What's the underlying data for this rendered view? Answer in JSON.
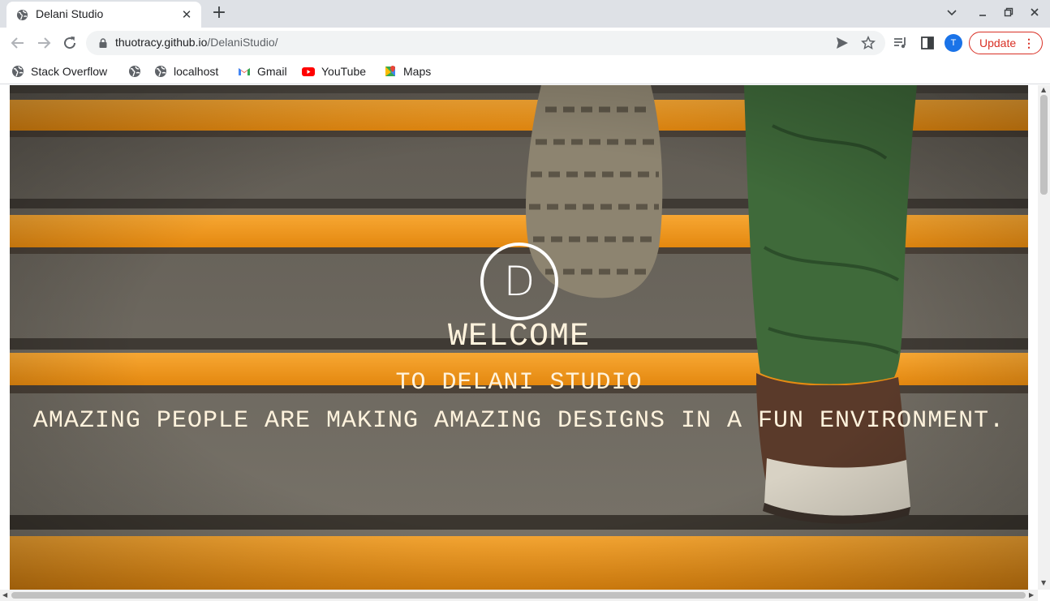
{
  "browser": {
    "tab_title": "Delani Studio",
    "tab_close": "✕",
    "new_tab": "+",
    "url_host": "thuotracy.github.io",
    "url_path": "/DelaniStudio/",
    "avatar_letter": "T",
    "update_label": "Update",
    "update_menu": "⋮"
  },
  "bookmarks": [
    {
      "label": "Stack Overflow",
      "icon": "globe-icon"
    },
    {
      "label": "",
      "icon": "globe-icon"
    },
    {
      "label": "localhost",
      "icon": "globe-icon"
    },
    {
      "label": "Gmail",
      "icon": "gmail-icon"
    },
    {
      "label": "YouTube",
      "icon": "youtube-icon"
    },
    {
      "label": "Maps",
      "icon": "maps-icon"
    }
  ],
  "hero": {
    "logo_letter": "D",
    "welcome": "WELCOME",
    "subtitle": "TO DELANI STUDIO",
    "tagline": "AMAZING PEOPLE ARE MAKING AMAZING DESIGNS IN A FUN ENVIRONMENT."
  },
  "colors": {
    "stripe_orange": "#f39a1e",
    "step_gray": "#6e6a62",
    "text_cream": "#fff3dd"
  }
}
